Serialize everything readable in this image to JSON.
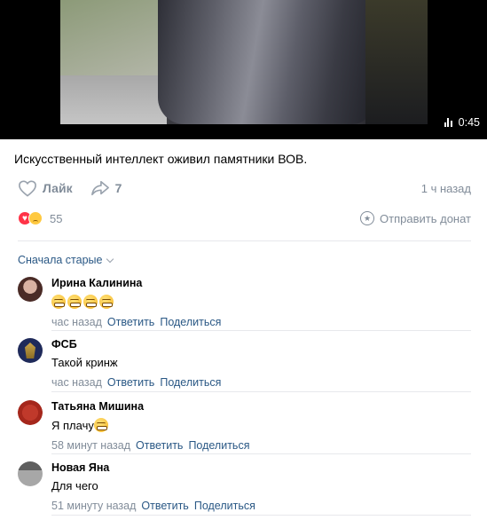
{
  "video": {
    "duration": "0:45"
  },
  "post": {
    "text": "Искусственный интеллект оживил памятники ВОВ."
  },
  "actions": {
    "like_label": "Лайк",
    "share_count": "7",
    "time_ago": "1 ч назад"
  },
  "reactions": {
    "count": "55",
    "donate_label": "Отправить донат"
  },
  "sort": {
    "label": "Сначала старые"
  },
  "comments": [
    {
      "author": "Ирина Калинина",
      "text": "",
      "emoji_count": 4,
      "time": "час назад",
      "reply": "Ответить",
      "share": "Поделиться"
    },
    {
      "author": "ФСБ",
      "text": "Такой кринж",
      "time": "час назад",
      "reply": "Ответить",
      "share": "Поделиться"
    },
    {
      "author": "Татьяна Мишина",
      "text": "Я плачу",
      "time": "58 минут назад",
      "reply": "Ответить",
      "share": "Поделиться"
    },
    {
      "author": "Новая Яна",
      "text": "Для чего",
      "time": "51 минуту назад",
      "reply": "Ответить",
      "share": "Поделиться"
    }
  ],
  "colors": {
    "link": "#2a5885",
    "secondary": "#818c99",
    "separator": "#e7e8ec",
    "heart": "#ff3347"
  }
}
